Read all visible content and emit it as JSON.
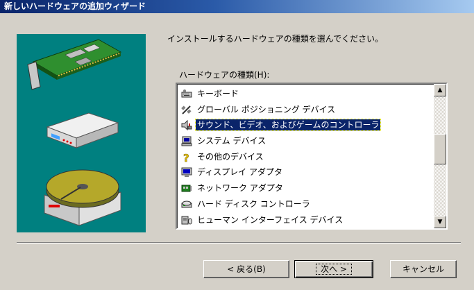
{
  "window": {
    "title": "新しいハードウェアの追加ウィザード"
  },
  "instruction": "インストールするハードウェアの種類を選んでください。",
  "list": {
    "label": "ハードウェアの種類(H):",
    "items": [
      {
        "label": "キーボード",
        "icon": "keyboard-icon",
        "selected": false
      },
      {
        "label": "グローバル ポジショニング デバイス",
        "icon": "satellite-icon",
        "selected": false
      },
      {
        "label": "サウンド、ビデオ、およびゲームのコントローラ",
        "icon": "speaker-joystick-icon",
        "selected": true
      },
      {
        "label": "システム デバイス",
        "icon": "computer-icon",
        "selected": false
      },
      {
        "label": "その他のデバイス",
        "icon": "question-icon",
        "selected": false
      },
      {
        "label": "ディスプレイ アダプタ",
        "icon": "monitor-icon",
        "selected": false
      },
      {
        "label": "ネットワーク アダプタ",
        "icon": "network-card-icon",
        "selected": false
      },
      {
        "label": "ハード ディスク コントローラ",
        "icon": "hard-disk-icon",
        "selected": false
      },
      {
        "label": "ヒューマン インターフェイス デバイス",
        "icon": "hid-icon",
        "selected": false
      }
    ]
  },
  "buttons": {
    "back": "< 戻る(B)",
    "next": "次へ >",
    "cancel": "キャンセル"
  },
  "colors": {
    "title_start": "#0a246a",
    "title_end": "#a6caf0",
    "selection": "#0a246a",
    "illustration_bg": "#008080",
    "face": "#d4d0c8"
  }
}
